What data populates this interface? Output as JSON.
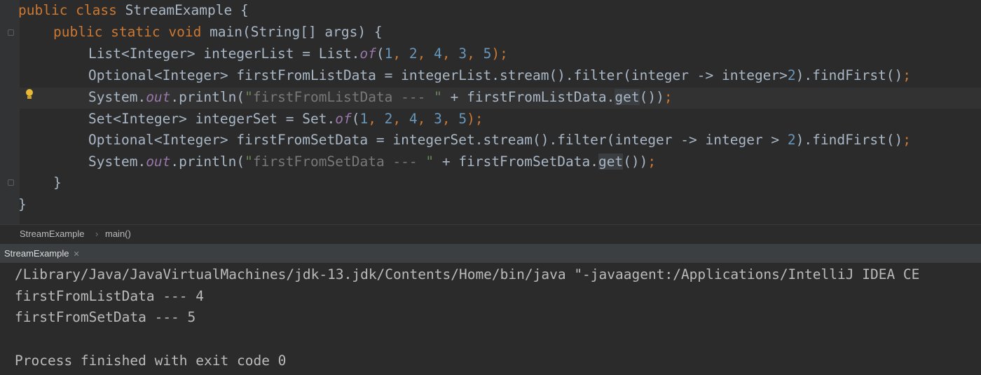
{
  "editor": {
    "lines": {
      "l1": {
        "kw": "public class ",
        "rest": "StreamExample {"
      },
      "l2": {
        "kw": "public static void ",
        "rest": "main(String[] args) {"
      },
      "l3": {
        "a": "List<Integer> integerList = List.",
        "of": "of",
        "b": "(",
        "n1": "1",
        "c1": ", ",
        "n2": "2",
        "c2": ", ",
        "n3": "4",
        "c3": ", ",
        "n4": "3",
        "c4": ", ",
        "n5": "5",
        "end": ");"
      },
      "l4": {
        "a": "Optional<Integer> firstFromListData = integerList.stream().filter(integer -> integer>",
        "n": "2",
        "b": ").findFirst()",
        "end": ";"
      },
      "l5": {
        "a": "System.",
        "out": "out",
        "b": ".println(",
        "s1": "\"",
        "sdim": "firstFromListData --- ",
        "s2": "\"",
        "c": " + firstFromListData.",
        "get": "get",
        "d": "())",
        "end": ";"
      },
      "l6": {
        "a": "Set<Integer> integerSet = Set.",
        "of": "of",
        "b": "(",
        "n1": "1",
        "c1": ", ",
        "n2": "2",
        "c2": ", ",
        "n3": "4",
        "c3": ", ",
        "n4": "3",
        "c4": ", ",
        "n5": "5",
        "end": ");"
      },
      "l7": {
        "a": "Optional<Integer> firstFromSetData = integerSet.stream().filter(integer -> integer > ",
        "n": "2",
        "b": ").findFirst()",
        "end": ";"
      },
      "l8": {
        "a": "System.",
        "out": "out",
        "b": ".println(",
        "s1": "\"",
        "sdim": "firstFromSetData --- ",
        "s2": "\"",
        "c": " + firstFromSetData.",
        "get": "get",
        "d": "())",
        "end": ";"
      },
      "l9": "}",
      "l10": "}"
    }
  },
  "breadcrumb": {
    "class": "StreamExample",
    "sep": "›",
    "method": "main()"
  },
  "run_panel": {
    "tab_label": "StreamExample",
    "close": "✕"
  },
  "console": {
    "lines": [
      "/Library/Java/JavaVirtualMachines/jdk-13.jdk/Contents/Home/bin/java \"-javaagent:/Applications/IntelliJ IDEA CE",
      "firstFromListData --- 4",
      "firstFromSetData --- 5",
      "",
      "Process finished with exit code 0"
    ]
  },
  "icons": {
    "bulb": "lightbulb-icon",
    "fold": "fold-marker-icon"
  }
}
